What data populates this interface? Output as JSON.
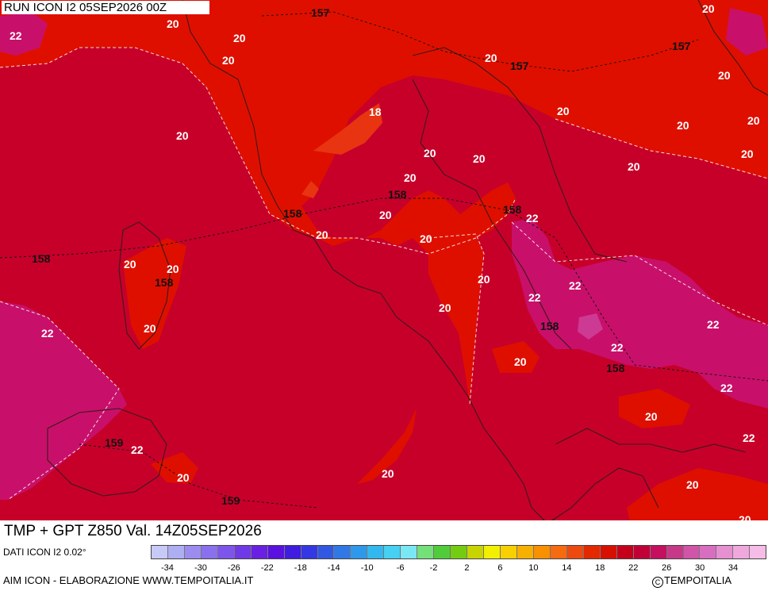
{
  "header": {
    "run_label": "RUN ICON I2 05SEP2026 00Z"
  },
  "footer": {
    "field_title": "TMP + GPT Z850 Val. 14Z05SEP2026",
    "data_source": "DATI ICON I2 0.02°",
    "credits": "AIM ICON - ELABORAZIONE WWW.TEMPOITALIA.IT",
    "copyright_symbol": "C",
    "copyright": "TEMPOITALIA"
  },
  "colors": {
    "t18": "#e83410",
    "t20": "#df0f00",
    "t22": "#c7002a",
    "t24": "#c8106a",
    "t26": "#cc3a94",
    "land_border": "#3a1a1a"
  },
  "colorbar": {
    "colors": [
      "#c7c9f6",
      "#aeaef2",
      "#9c8cf0",
      "#8a70ec",
      "#7d55ea",
      "#7039e6",
      "#6a20e2",
      "#5a10e0",
      "#3f1ce0",
      "#3338e2",
      "#3158e2",
      "#3078e4",
      "#2f98ea",
      "#32b8ee",
      "#46d0f2",
      "#7ae8f4",
      "#74e07a",
      "#50cc3a",
      "#74cc10",
      "#c8d400",
      "#f2f000",
      "#f8d000",
      "#f8b000",
      "#f89000",
      "#f66a10",
      "#ec4a10",
      "#e42800",
      "#d81000",
      "#c4001a",
      "#c00036",
      "#c4105e",
      "#c83888",
      "#d055a8",
      "#d86ec0",
      "#e690d2",
      "#f0a8dc",
      "#f4bce6"
    ],
    "labels": [
      "-34",
      "-30",
      "-26",
      "-22",
      "-18",
      "-14",
      "-10",
      "-6",
      "-2",
      "2",
      "6",
      "10",
      "14",
      "18",
      "22",
      "26",
      "30",
      "34"
    ]
  },
  "map_labels": {
    "temperature": [
      "22",
      "20",
      "20",
      "20",
      "20",
      "20",
      "20",
      "20",
      "20",
      "20",
      "18",
      "20",
      "20",
      "20",
      "20",
      "20",
      "20",
      "20",
      "20",
      "20",
      "20",
      "20",
      "20",
      "20",
      "20",
      "20",
      "22",
      "22",
      "22",
      "22",
      "22",
      "22",
      "22",
      "22",
      "22",
      "20",
      "20",
      "20",
      "20",
      "20",
      "20",
      "20",
      "20",
      "20",
      "20",
      "20",
      "20",
      "20",
      "20"
    ],
    "geopotential": [
      "157",
      "157",
      "157",
      "158",
      "158",
      "158",
      "158",
      "158",
      "158",
      "158",
      "159",
      "159"
    ]
  }
}
